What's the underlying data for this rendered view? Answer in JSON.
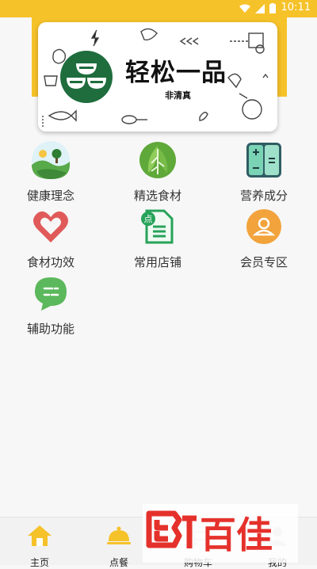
{
  "status": {
    "time": "10:11"
  },
  "banner": {
    "title": "轻松一品",
    "subtitle": "非清真"
  },
  "menu": [
    {
      "label": "健康理念",
      "icon": "landscape-icon"
    },
    {
      "label": "精选食材",
      "icon": "cabbage-icon"
    },
    {
      "label": "营养成分",
      "icon": "calculator-icon"
    },
    {
      "label": "食材功效",
      "icon": "heart-icon"
    },
    {
      "label": "常用店铺",
      "icon": "shop-document-icon"
    },
    {
      "label": "会员专区",
      "icon": "member-icon"
    },
    {
      "label": "辅助功能",
      "icon": "chat-bubble-icon"
    }
  ],
  "nav": [
    {
      "label": "主页",
      "icon": "home-icon"
    },
    {
      "label": "点餐",
      "icon": "dish-cloche-icon"
    },
    {
      "label": "购物车",
      "icon": "cart-icon"
    },
    {
      "label": "我的",
      "icon": "user-icon"
    }
  ],
  "watermark": {
    "text": "百佳"
  },
  "colors": {
    "accent": "#f6c22a",
    "brand_green": "#1f6d3d"
  }
}
